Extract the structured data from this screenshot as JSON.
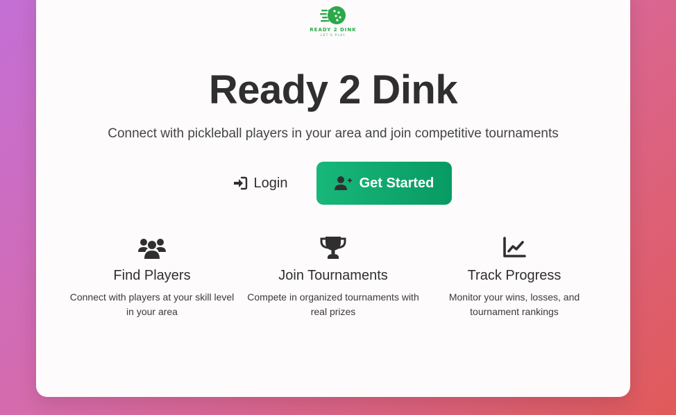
{
  "logo": {
    "name": "READY 2 DINK",
    "tagline": "LET'S PLAY"
  },
  "hero": {
    "title": "Ready 2 Dink",
    "subtitle": "Connect with pickleball players in your area and join competitive tournaments"
  },
  "actions": {
    "login_label": "Login",
    "get_started_label": "Get Started"
  },
  "features": [
    {
      "icon": "users-icon",
      "title": "Find Players",
      "description": "Connect with players at your skill level in your area"
    },
    {
      "icon": "trophy-icon",
      "title": "Join Tournaments",
      "description": "Compete in organized tournaments with real prizes"
    },
    {
      "icon": "chart-line-icon",
      "title": "Track Progress",
      "description": "Monitor your wins, losses, and tournament rankings"
    }
  ],
  "colors": {
    "accent": "#10a96e",
    "logo": "#2aa84a",
    "text": "#2f2f2f",
    "card": "#fdfbfb"
  }
}
